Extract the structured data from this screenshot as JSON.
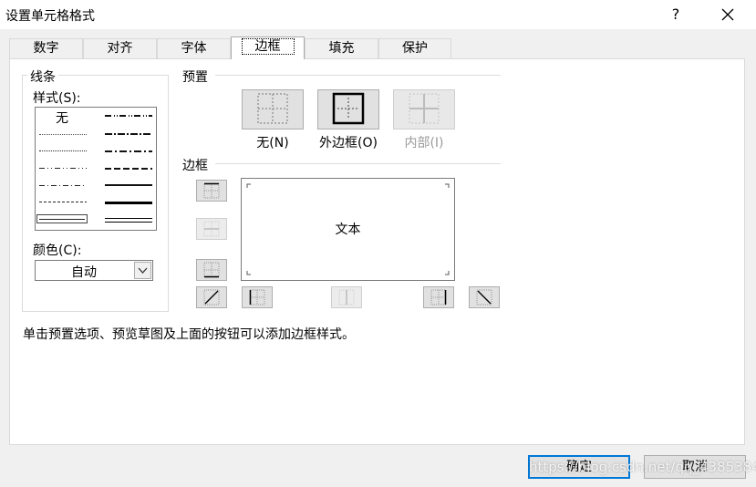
{
  "window": {
    "title": "设置单元格格式",
    "help_label": "?",
    "close_icon": "close-icon"
  },
  "tabs": [
    {
      "label": "数字"
    },
    {
      "label": "对齐"
    },
    {
      "label": "字体"
    },
    {
      "label": "边框",
      "active": true
    },
    {
      "label": "填充"
    },
    {
      "label": "保护"
    }
  ],
  "line_group": {
    "title": "线条",
    "style_label": "样式(S):",
    "none_style": "无",
    "color_label": "颜色(C):",
    "color_value": "自动"
  },
  "presets": {
    "title": "预置",
    "none_label": "无(N)",
    "outline_label": "外边框(O)",
    "inside_label": "内部(I)"
  },
  "border": {
    "title": "边框",
    "preview_text": "文本"
  },
  "hint": "单击预置选项、预览草图及上面的按钮可以添加边框样式。",
  "buttons": {
    "ok": "确定",
    "cancel": "取消"
  },
  "watermark": "https://blog.csdn.net/qq_43853841"
}
